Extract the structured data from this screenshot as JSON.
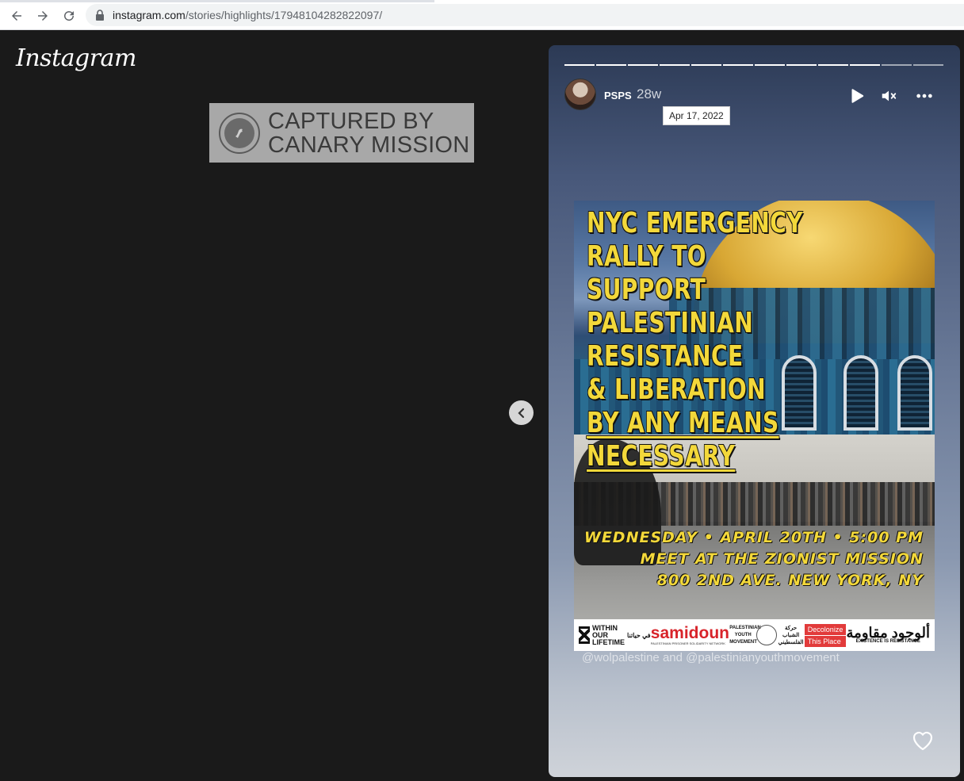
{
  "browser": {
    "url_host": "instagram.com",
    "url_path": "/stories/highlights/17948104282822097/"
  },
  "instagram": {
    "logo": "Instagram"
  },
  "watermark": {
    "line1": "CAPTURED BY",
    "line2": "CANARY MISSION"
  },
  "story": {
    "username": "PSPS",
    "time_ago": "28w",
    "tooltip_date": "Apr 17, 2022",
    "progress": {
      "segments": 12,
      "current_index": 9
    },
    "caption": "@wolpalestine and @palestinianyouthmovement"
  },
  "poster": {
    "headline_lines": [
      "NYC EMERGENCY",
      "RALLY TO SUPPORT",
      "PALESTINIAN",
      "RESISTANCE",
      "& LIBERATION",
      "BY ANY MEANS",
      "NECESSARY"
    ],
    "event_line1": "WEDNESDAY • APRIL 20TH • 5:00 PM",
    "event_line2": "MEET AT THE ZIONIST MISSION",
    "event_line3": "800 2ND AVE. NEW YORK, NY",
    "logos": {
      "within_l1": "WITHIN",
      "within_l2": "OUR",
      "within_l3": "LIFETIME",
      "within_ar": "في حياتنا",
      "samidoun": "samidoun",
      "samidoun_sub": "PALESTINIAN PRISONER SOLIDARITY NETWORK",
      "pym": "PALESTINIAN YOUTH MOVEMENT",
      "pym_ar": "حركة الشباب الفلسطيني",
      "decolonize": "Decolonize",
      "this_place": "This Place",
      "existence_ar": "ألوجود مقاومة",
      "existence": "EXISTENCE IS RESISTANCE"
    }
  },
  "colors": {
    "poster_text": "#f3d83a",
    "page_bg": "#1a1a1a"
  }
}
